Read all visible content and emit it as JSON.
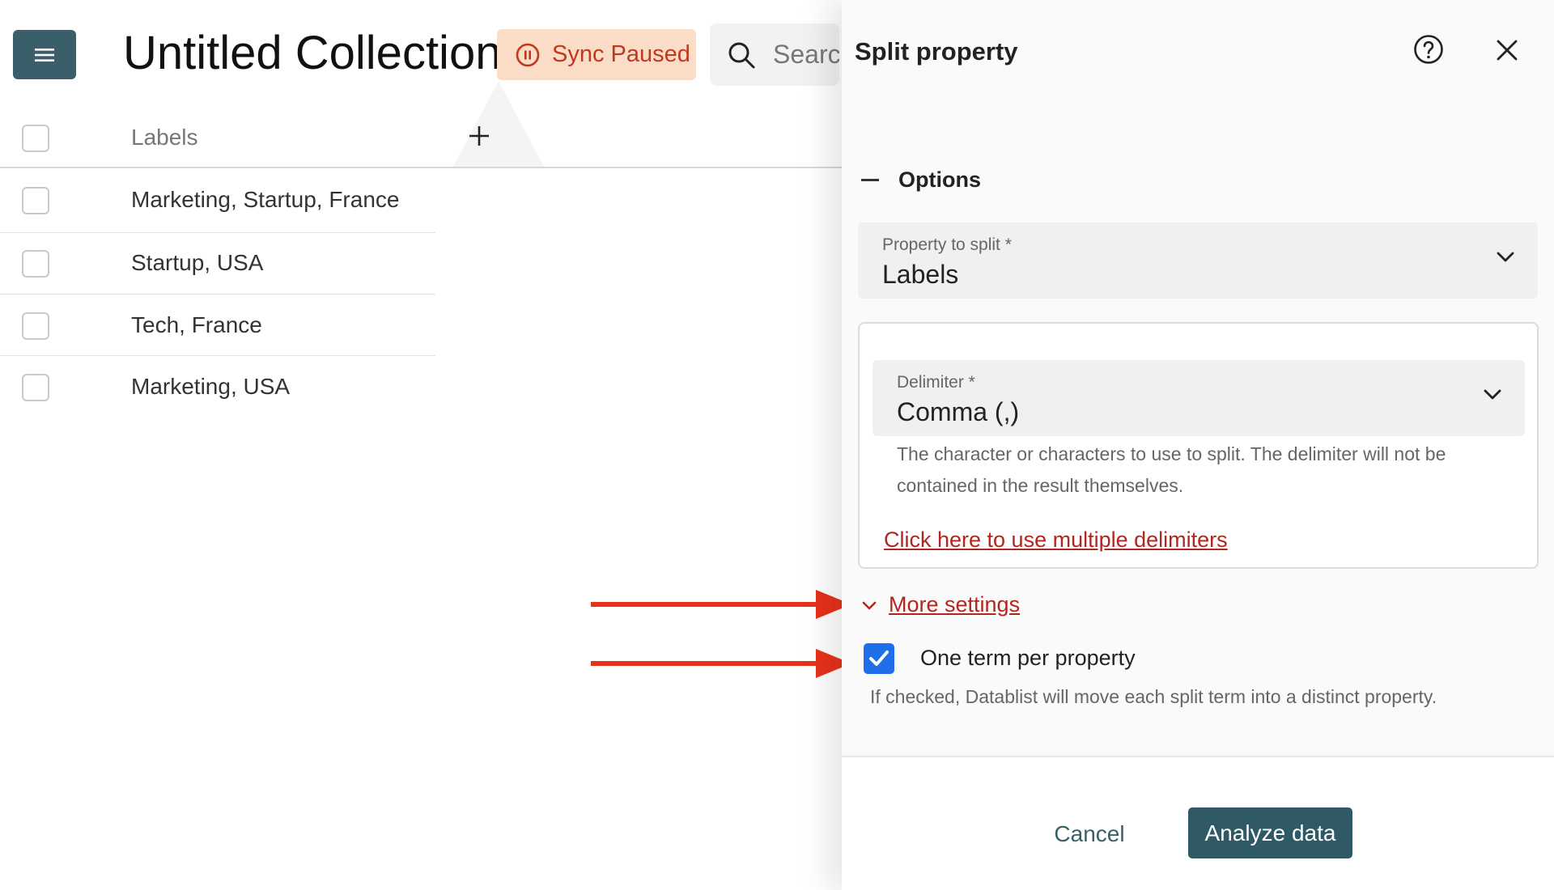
{
  "header": {
    "title": "Untitled Collection",
    "sync_status": "Sync Paused",
    "search_placeholder": "Search"
  },
  "table": {
    "column_header": "Labels",
    "rows": [
      {
        "labels": "Marketing, Startup, France"
      },
      {
        "labels": "Startup, USA"
      },
      {
        "labels": "Tech, France"
      },
      {
        "labels": "Marketing, USA"
      }
    ]
  },
  "panel": {
    "title": "Split property",
    "options_label": "Options",
    "property_to_split": {
      "label": "Property to split *",
      "value": "Labels"
    },
    "delimiter": {
      "label": "Delimiter *",
      "value": "Comma (,)"
    },
    "delimiter_help": "The character or characters to use to split. The delimiter will not be contained in the result themselves.",
    "multiple_delimiters_link": "Click here to use multiple delimiters",
    "more_settings_link": "More settings",
    "one_term_per_property": {
      "label": "One term per property",
      "checked": true
    },
    "one_term_help": "If checked, Datablist will move each split term into a distinct property.",
    "cancel_label": "Cancel",
    "analyze_label": "Analyze data"
  },
  "colors": {
    "primary": "#2f5964",
    "link": "#b3261e",
    "sync_badge_bg": "#fbdcc6",
    "checkbox_checked": "#1e6fe8",
    "annotation_arrow": "#e8321a"
  },
  "icons": [
    "menu-icon",
    "pause-icon",
    "search-icon",
    "plus-icon",
    "help-icon",
    "close-icon",
    "chevron-down-icon",
    "checkmark-icon",
    "arrow-right-icon"
  ]
}
